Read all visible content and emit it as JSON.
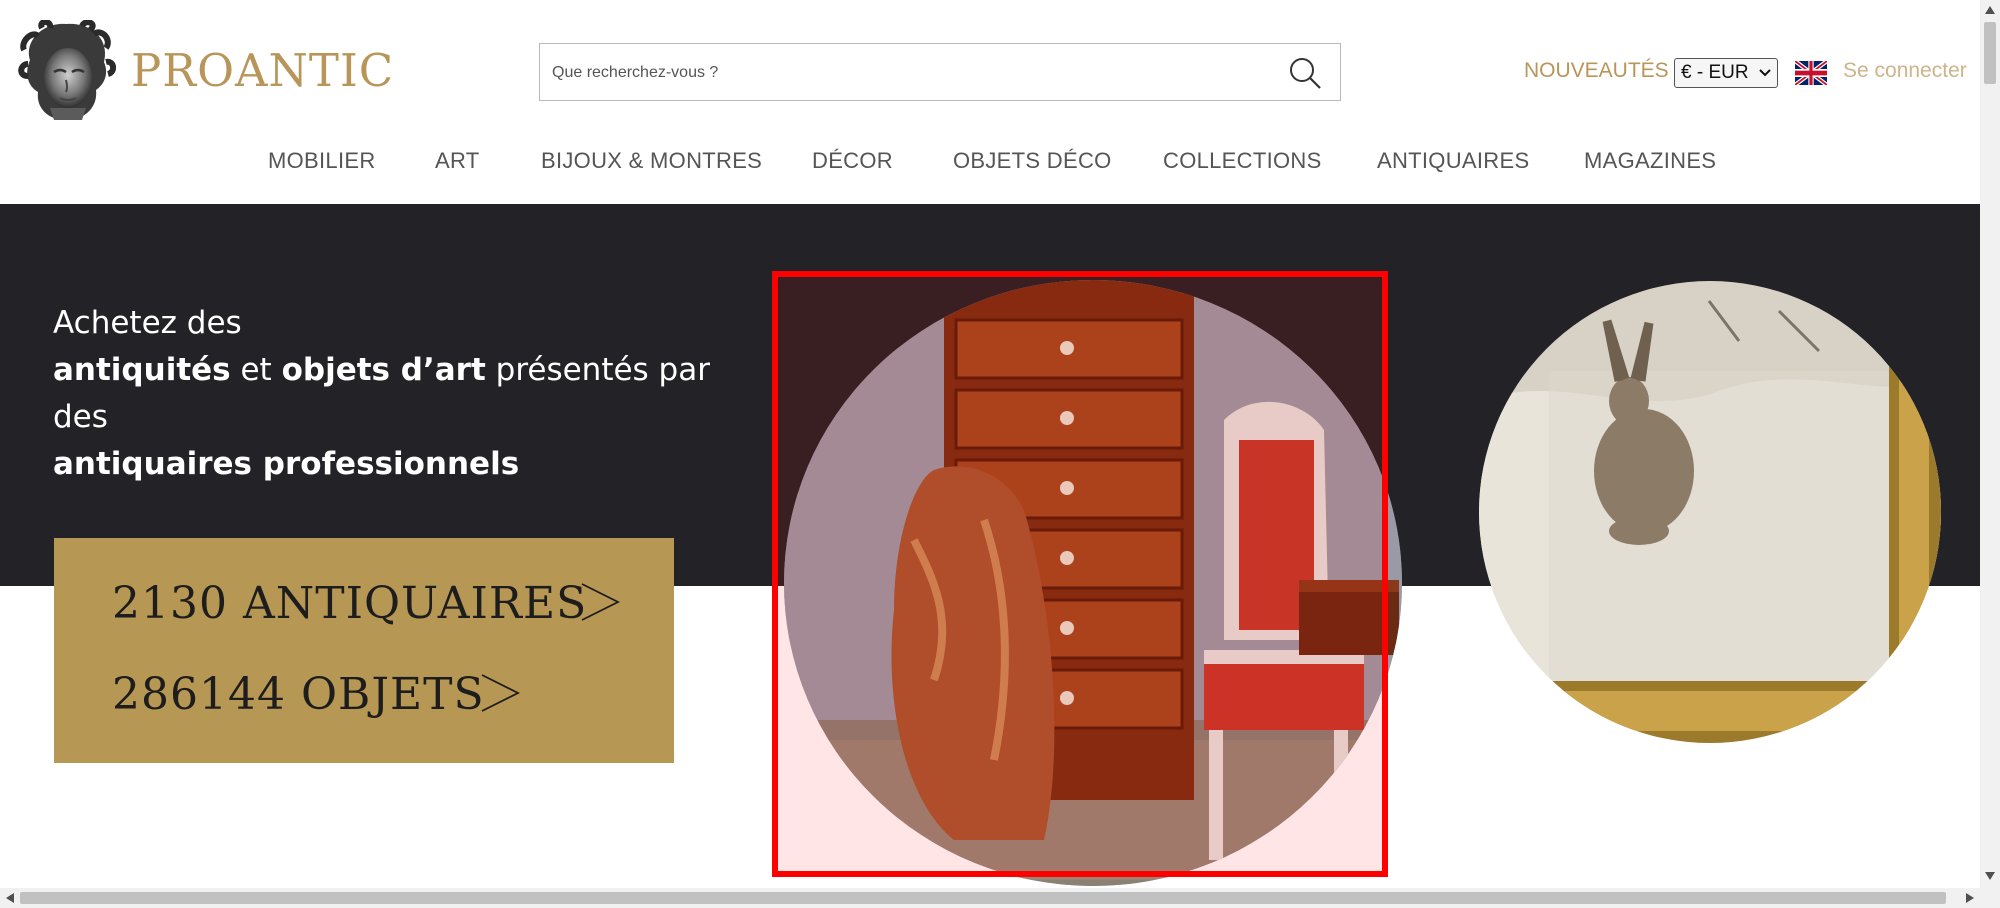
{
  "header": {
    "logo_text": "PROANTIC",
    "search_placeholder": "Que recherchez-vous ?",
    "nouveautes": "NOUVEAUTÉS",
    "currency": "€ - EUR",
    "login": "Se connecter",
    "language_flag": "uk-flag-icon"
  },
  "nav": {
    "items": [
      "MOBILIER",
      "ART",
      "BIJOUX & MONTRES",
      "DÉCOR",
      "OBJETS DÉCO",
      "COLLECTIONS",
      "ANTIQUAIRES",
      "MAGAZINES"
    ]
  },
  "hero": {
    "line1": "Achetez des",
    "line2_b1": "antiquités",
    "line2_mid": "et",
    "line2_b2": "objets d’art",
    "line2_end": "présentés par des",
    "line3": "antiquaires professionnels",
    "stat1": "2130 ANTIQUAIRES",
    "stat2": "286144 OBJETS"
  },
  "colors": {
    "brand_gold": "#b8965a",
    "dark_band": "#232226",
    "stats_box": "#b79754",
    "highlight": "#ff0000"
  }
}
